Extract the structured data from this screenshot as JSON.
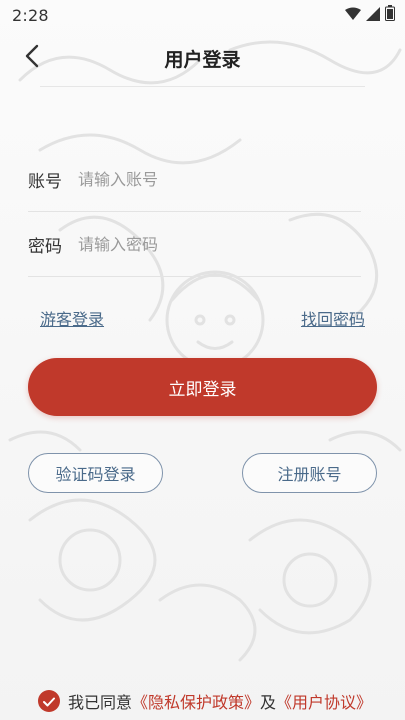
{
  "status_bar": {
    "time": "2:28",
    "icons": [
      "wifi-icon",
      "signal-icon",
      "battery-icon"
    ]
  },
  "header": {
    "title": "用户登录",
    "back_icon": "chevron-left-icon"
  },
  "form": {
    "account": {
      "label": "账号",
      "placeholder": "请输入账号",
      "value": ""
    },
    "password": {
      "label": "密码",
      "placeholder": "请输入密码",
      "value": ""
    }
  },
  "links": {
    "guest_login": "游客登录",
    "find_password": "找回密码"
  },
  "buttons": {
    "login": "立即登录",
    "sms_login": "验证码登录",
    "register": "注册账号"
  },
  "agreement": {
    "checked": true,
    "prefix": "我已同意",
    "privacy_policy": "《隐私保护政策》",
    "conjunction": "及",
    "user_agreement": "《用户协议》"
  },
  "colors": {
    "accent": "#c0392b",
    "link": "#4a6a8a",
    "outline": "#7f93ab"
  }
}
